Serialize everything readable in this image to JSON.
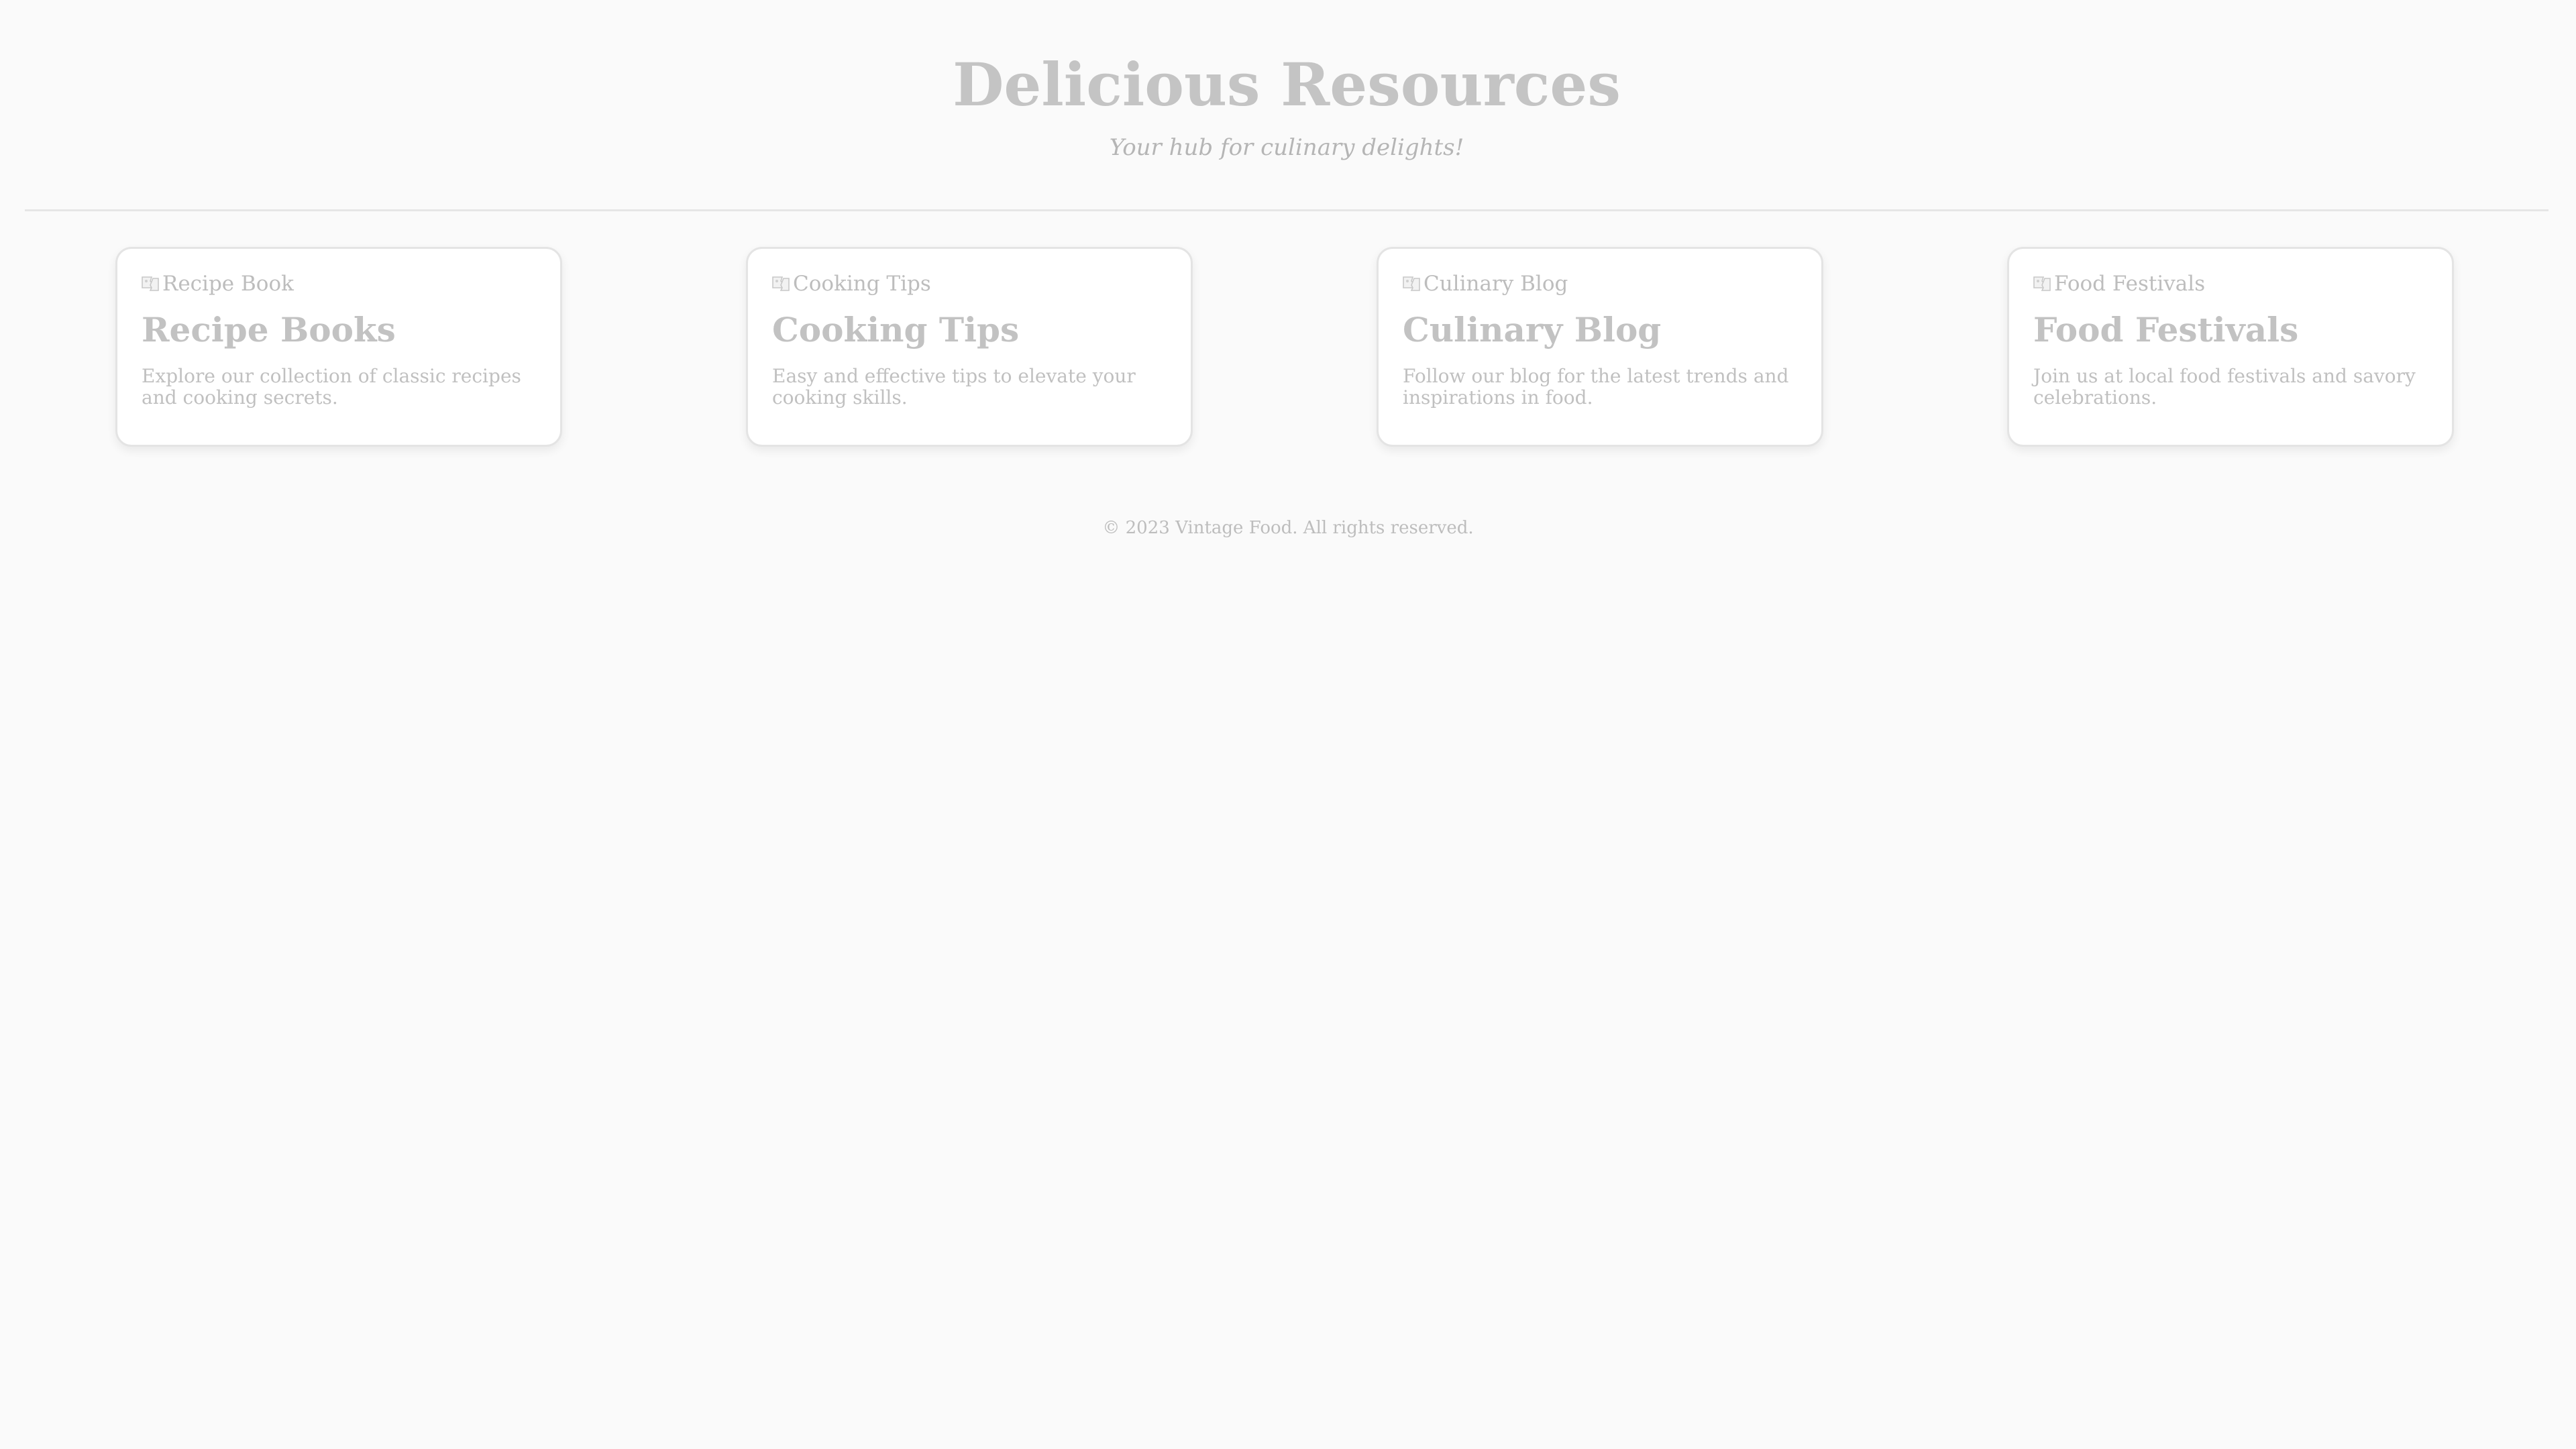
{
  "header": {
    "title": "Delicious Resources",
    "tagline": "Your hub for culinary delights!"
  },
  "cards": [
    {
      "image_alt": "Recipe Book",
      "image_icon": "broken-image-icon",
      "title": "Recipe Books",
      "description": "Explore our collection of classic recipes and cooking secrets."
    },
    {
      "image_alt": "Cooking Tips",
      "image_icon": "broken-image-icon",
      "title": "Cooking Tips",
      "description": "Easy and effective tips to elevate your cooking skills."
    },
    {
      "image_alt": "Culinary Blog",
      "image_icon": "broken-image-icon",
      "title": "Culinary Blog",
      "description": "Follow our blog for the latest trends and inspirations in food."
    },
    {
      "image_alt": "Food Festivals",
      "image_icon": "broken-image-icon",
      "title": "Food Festivals",
      "description": "Join us at local food festivals and savory celebrations."
    }
  ],
  "footer": {
    "copyright": "© 2023 Vintage Food. All rights reserved."
  },
  "colors": {
    "background": "#fafafa",
    "card_background": "#ffffff",
    "text": "#bdbdbd",
    "divider": "#e6e6e6"
  }
}
